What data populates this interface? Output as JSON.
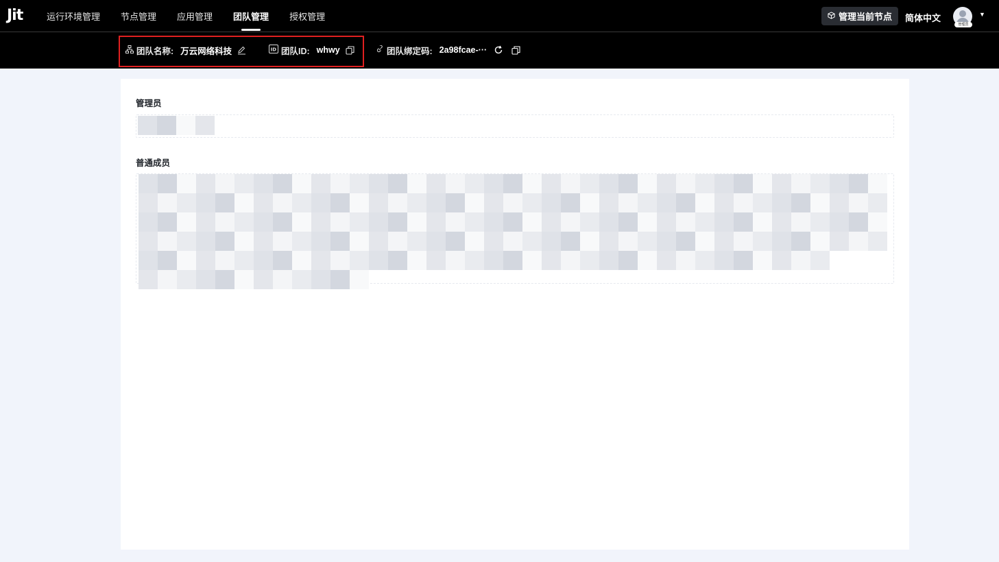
{
  "app": {
    "logo": "Jit"
  },
  "nav": {
    "items": [
      {
        "label": "运行环境管理",
        "active": false
      },
      {
        "label": "节点管理",
        "active": false
      },
      {
        "label": "应用管理",
        "active": false
      },
      {
        "label": "团队管理",
        "active": true
      },
      {
        "label": "授权管理",
        "active": false
      }
    ]
  },
  "header": {
    "manage_node_label": "管理当前节点",
    "language": "简体中文",
    "avatar_tag": "管理员"
  },
  "team": {
    "name_label": "团队名称:",
    "name_value": "万云网络科技",
    "id_label": "团队ID:",
    "id_value": "whwy",
    "bind_code_label": "团队绑定码:",
    "bind_code_value": "2a98fcae-···"
  },
  "sections": {
    "admins_title": "管理员",
    "members_title": "普通成员"
  },
  "colors": {
    "accent_highlight": "#e02020",
    "header_bg": "#000000",
    "page_bg": "#f1f4fb"
  }
}
